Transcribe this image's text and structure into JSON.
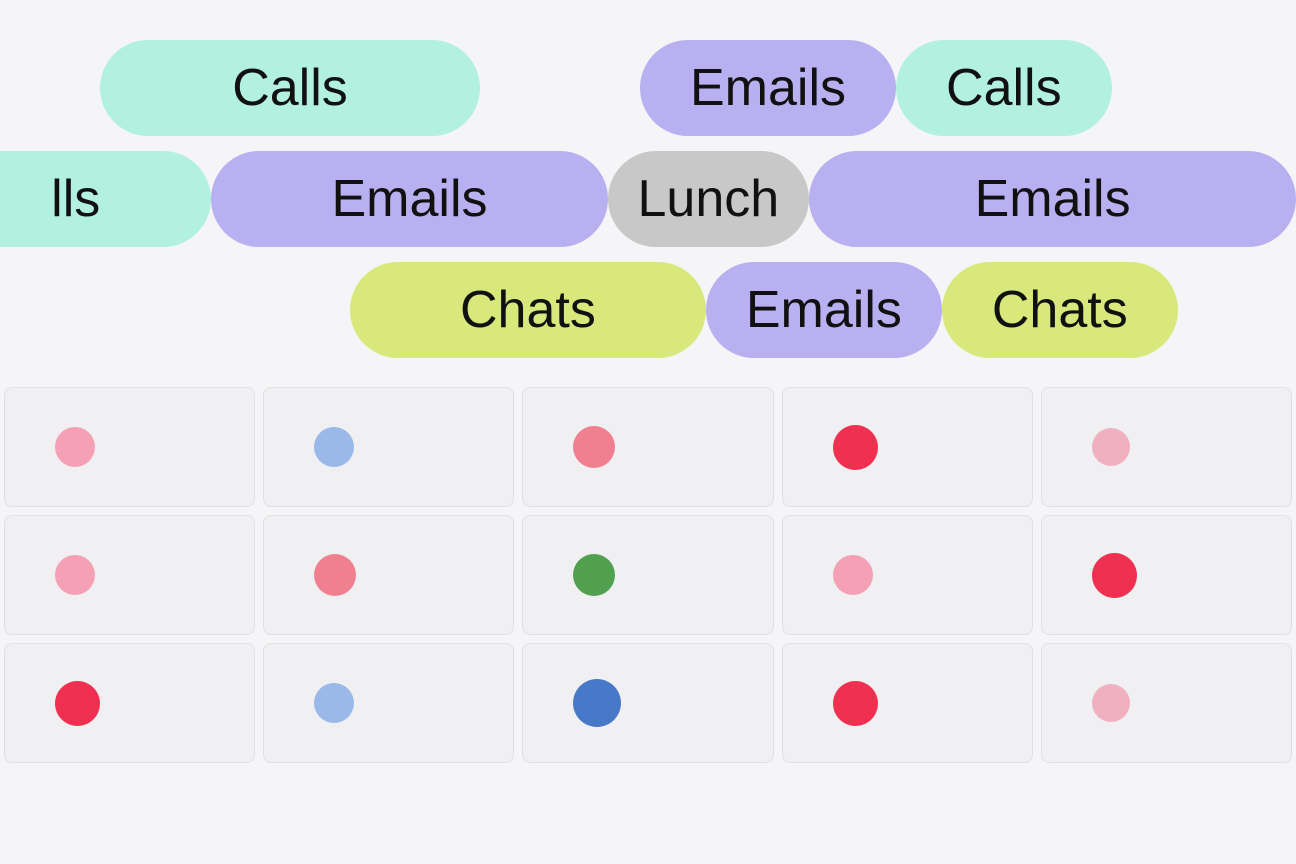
{
  "tags": {
    "row1": [
      {
        "label": "Calls",
        "color": "mint",
        "id": "calls-1"
      },
      {
        "label": "Emails",
        "color": "purple",
        "id": "emails-1"
      },
      {
        "label": "Calls",
        "color": "mint",
        "id": "calls-2"
      }
    ],
    "row2": [
      {
        "label": "lls",
        "color": "mint",
        "id": "lls-1"
      },
      {
        "label": "Emails",
        "color": "purple",
        "id": "emails-2"
      },
      {
        "label": "Lunch",
        "color": "gray",
        "id": "lunch-1"
      },
      {
        "label": "Emails",
        "color": "purple",
        "id": "emails-3"
      }
    ],
    "row3": [
      {
        "label": "Chats",
        "color": "yellow",
        "id": "chats-1"
      },
      {
        "label": "Emails",
        "color": "purple",
        "id": "emails-4"
      },
      {
        "label": "Chats",
        "color": "yellow",
        "id": "chats-2"
      }
    ]
  },
  "grid": {
    "rows": [
      [
        {
          "dot": "pink-light",
          "size": 40
        },
        {
          "dot": "blue-light",
          "size": 40
        },
        {
          "dot": "pink-medium",
          "size": 42
        },
        {
          "dot": "red",
          "size": 45
        },
        {
          "dot": "pink-pale",
          "size": 38
        }
      ],
      [
        {
          "dot": "pink-light",
          "size": 38
        },
        {
          "dot": "pink-medium",
          "size": 40
        },
        {
          "dot": "green",
          "size": 42
        },
        {
          "dot": "pink-light",
          "size": 40
        },
        {
          "dot": "red",
          "size": 45
        }
      ],
      [
        {
          "dot": "red",
          "size": 45
        },
        {
          "dot": "blue-light",
          "size": 42
        },
        {
          "dot": "blue-deep",
          "size": 48
        },
        {
          "dot": "red",
          "size": 44
        },
        {
          "dot": "pink-pale",
          "size": 38
        }
      ]
    ]
  },
  "colors": {
    "mint": "#b2f0e0",
    "purple": "#b8b0f0",
    "yellow": "#d8e87a",
    "gray": "#c8c8c8",
    "background": "#f5f5f7",
    "gridCell": "#f0f0f2",
    "gridBorder": "#e0e0e0"
  }
}
